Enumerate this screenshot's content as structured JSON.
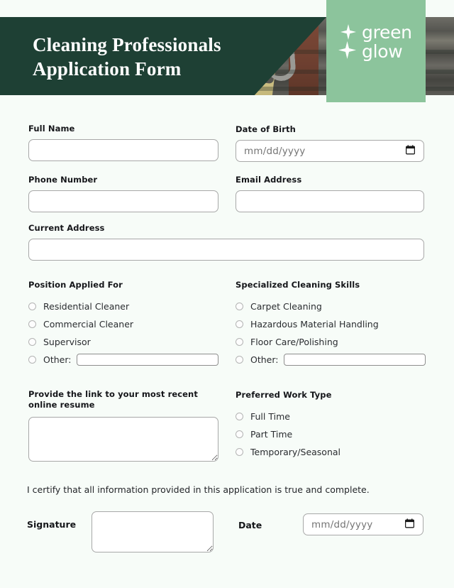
{
  "header": {
    "title_line1": "Cleaning Professionals",
    "title_line2": "Application Form",
    "logo_line1": "green",
    "logo_line2": "glow",
    "colors": {
      "dark_green": "#1e4034",
      "logo_green": "#8cc49c",
      "page_bg": "#f7fcf8"
    }
  },
  "fields": {
    "full_name": {
      "label": "Full Name",
      "value": "",
      "placeholder": ""
    },
    "date_of_birth": {
      "label": "Date of Birth",
      "value": "",
      "placeholder": "mm/dd/yyyy"
    },
    "phone_number": {
      "label": "Phone Number",
      "value": "",
      "placeholder": ""
    },
    "email_address": {
      "label": "Email Address",
      "value": "",
      "placeholder": ""
    },
    "current_address": {
      "label": "Current Address",
      "value": "",
      "placeholder": ""
    },
    "resume_link": {
      "label": "Provide the link to your most recent online resume",
      "value": "",
      "placeholder": ""
    },
    "signature": {
      "label": "Signature",
      "value": ""
    },
    "date": {
      "label": "Date",
      "value": "",
      "placeholder": "mm/dd/yyyy"
    }
  },
  "position_applied_for": {
    "label": "Position Applied For",
    "options": [
      {
        "label": "Residential Cleaner",
        "selected": false
      },
      {
        "label": "Commercial Cleaner",
        "selected": false
      },
      {
        "label": "Supervisor",
        "selected": false
      }
    ],
    "other": {
      "label": "Other:",
      "value": "",
      "selected": false
    }
  },
  "specialized_cleaning_skills": {
    "label": "Specialized Cleaning Skills",
    "options": [
      {
        "label": "Carpet Cleaning",
        "selected": false
      },
      {
        "label": "Hazardous Material Handling",
        "selected": false
      },
      {
        "label": "Floor Care/Polishing",
        "selected": false
      }
    ],
    "other": {
      "label": "Other:",
      "value": "",
      "selected": false
    }
  },
  "preferred_work_type": {
    "label": "Preferred Work Type",
    "options": [
      {
        "label": "Full Time",
        "selected": false
      },
      {
        "label": "Part Time",
        "selected": false
      },
      {
        "label": "Temporary/Seasonal",
        "selected": false
      }
    ]
  },
  "certification_text": "I certify that all information provided in this application is true and complete."
}
